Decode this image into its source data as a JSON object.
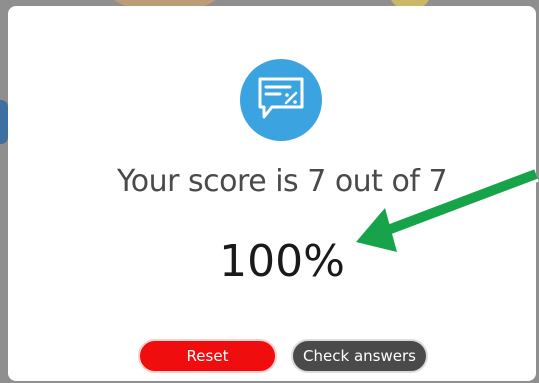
{
  "score": {
    "message": "Your score is 7 out of 7",
    "percent": "100%"
  },
  "buttons": {
    "reset_label": "Reset",
    "check_label": "Check answers"
  },
  "colors": {
    "icon_bg": "#3aa3e0",
    "reset_bg": "#f00d0d",
    "check_bg": "#4a4a4a",
    "arrow": "#16a34a"
  },
  "icons": {
    "result_icon": "chat-bubble-percent-icon"
  }
}
